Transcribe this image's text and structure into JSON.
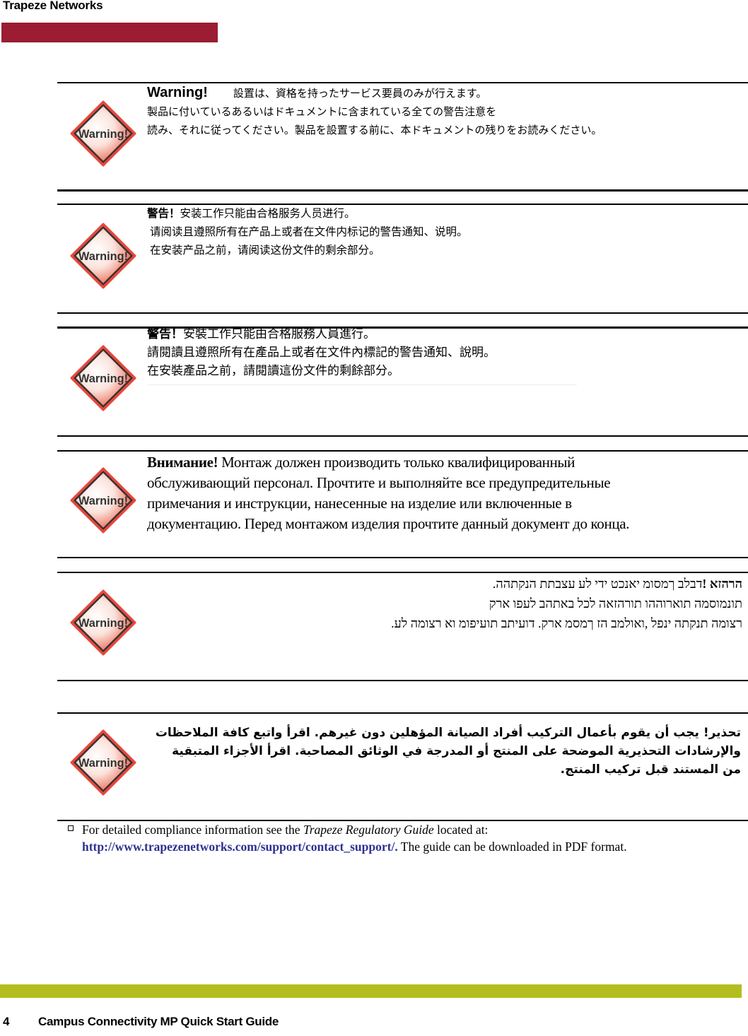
{
  "header": {
    "brand": "Trapeze Networks",
    "bar_color": "#9b1c33"
  },
  "warning_icon": {
    "label": "Warning!",
    "border_color": "#e8473b",
    "icon": "warning-diamond-icon"
  },
  "sections": {
    "japanese": {
      "title": "Warning!",
      "line1": "設置は、資格を持ったサービス要員のみが行えます。",
      "line2": "製品に付いているあるいはドキュメントに含まれている全ての警告注意を",
      "line3": "読み、それに従ってください。製品を設置する前に、本ドキュメントの残りをお読みください。"
    },
    "chinese_simplified": {
      "title": "警告！",
      "line1": "安装工作只能由合格服务人员进行。",
      "line2": "请阅读且遵照所有在产品上或者在文件内标记的警告通知、说明。",
      "line3": "在安装产品之前，请阅读这份文件的剩余部分。"
    },
    "chinese_traditional": {
      "title": "警告！",
      "line1": "安裝工作只能由合格服務人員進行。",
      "line2": "請閱讀且遵照所有在產品上或者在文件內標記的警告通知、說明。",
      "line3": "在安裝產品之前，請閱讀這份文件的剩餘部分。"
    },
    "russian": {
      "title": "Внимание!",
      "line1": " Монтаж должен производить только квалифицированный",
      "line2": "обслуживающий персонал. Прочтите и выполняйте все предупредительные",
      "line3": "примечания и инструкции, нанесенные на изделие или включенные в",
      "line4": "документацию. Перед монтажом изделия прочтите данный документ до конца."
    },
    "hebrew": {
      "title": "הרהזא !",
      "line1": "דבלב ךמסומ יאנכט ידי לע עצבתת הנקתהה.",
      "line2": "תונמוסמה תוארוההו תורהזאה לכל באתהב לעפו ארק",
      "line3": "רצומה תנקתה ינפל ,ואולמב הז ךמסמ ארק. דועיתב תועיפומ וא רצומה לע."
    },
    "arabic": {
      "text": "تحذير! يجب أن يقوم بأعمال التركيب أفراد الصيانة المؤهلين دون غيرهم. اقرأ واتبع كافة الملاحظات والإرشادات التحذيرية الموضحة على المنتج أو المدرجة في الوثائق المصاحبة. اقرأ الأجزاء المتبقية من المستند قبل تركيب المنتج."
    }
  },
  "note": {
    "bullet": "checkbox-bullet",
    "text_before": "For detailed compliance information see the ",
    "guide_name": "Trapeze Regulatory Guide",
    "text_after": " located at:",
    "link": "http://www.trapezenetworks.com/support/contact_support/.",
    "text_end": " The guide can be downloaded in PDF format.",
    "link_color": "#2e3192"
  },
  "footer": {
    "page_number": "4",
    "title": "Campus Connectivity MP Quick Start Guide",
    "bar_color": "#b4bd1e"
  }
}
